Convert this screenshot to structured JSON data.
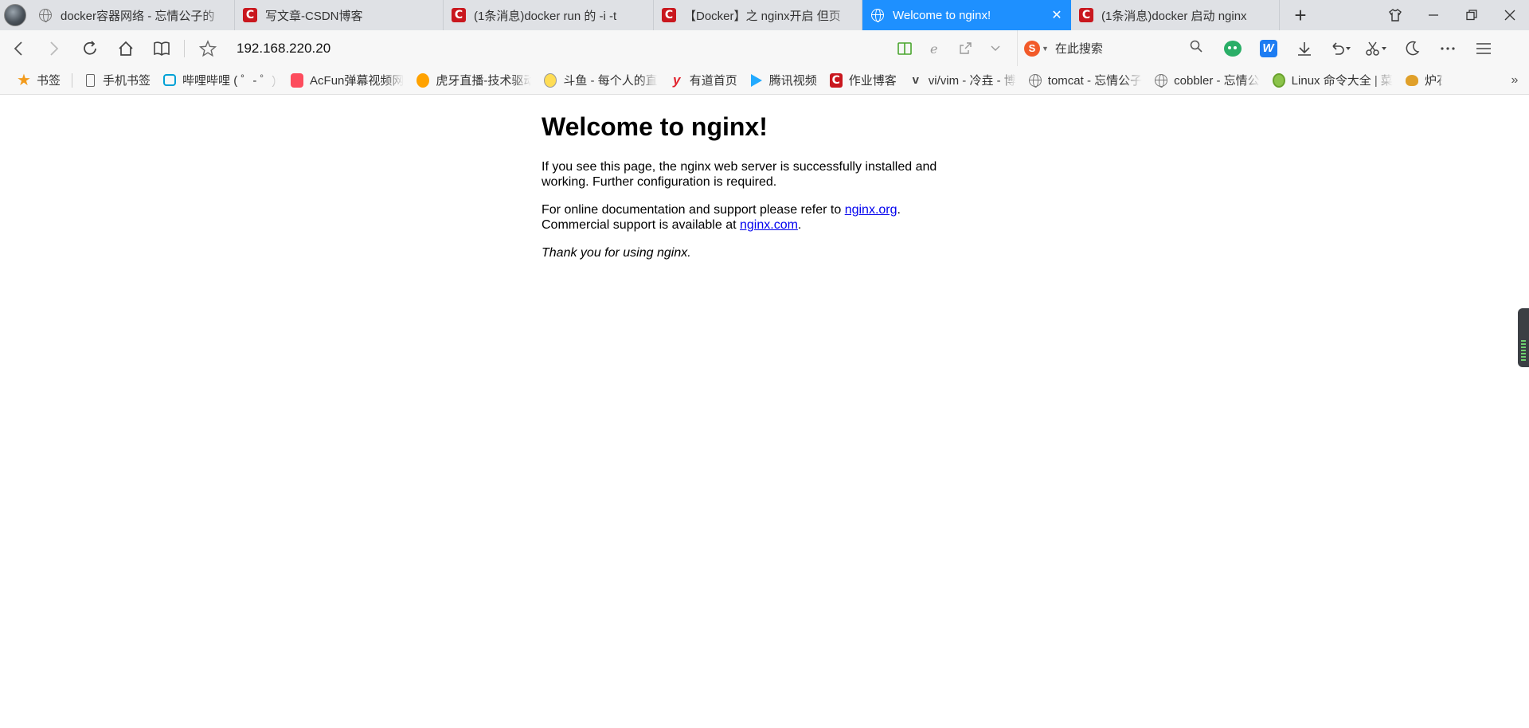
{
  "browser": {
    "tabs": [
      {
        "title": "docker容器网络 - 忘情公子的",
        "icon": "globe-icon",
        "active": false
      },
      {
        "title": "写文章-CSDN博客",
        "icon": "csdn-icon",
        "active": false
      },
      {
        "title": "(1条消息)docker run 的 -i -t",
        "icon": "csdn-icon",
        "active": false
      },
      {
        "title": "【Docker】之 nginx开启 但页",
        "icon": "csdn-icon",
        "active": false
      },
      {
        "title": "Welcome to nginx!",
        "icon": "globe-icon",
        "active": true
      },
      {
        "title": "(1条消息)docker 启动 nginx",
        "icon": "csdn-icon",
        "active": false
      }
    ],
    "new_tab_label": "+",
    "address": "192.168.220.20",
    "search_placeholder": "在此搜索",
    "colors": {
      "active_tab": "#1e90ff",
      "csdn_red": "#c9171e",
      "link": "#0000ee"
    }
  },
  "bookmarks": [
    {
      "label": "书签",
      "icon": "star-icon"
    },
    {
      "label": "手机书签",
      "icon": "phone-icon"
    },
    {
      "label": "哔哩哔哩 ( ゜- ゜)つ",
      "icon": "bilibili-icon"
    },
    {
      "label": "AcFun弹幕视频网",
      "icon": "acfun-icon"
    },
    {
      "label": "虎牙直播-技术驱动",
      "icon": "huya-icon"
    },
    {
      "label": "斗鱼 - 每个人的直",
      "icon": "douyu-icon"
    },
    {
      "label": "有道首页",
      "icon": "youdao-icon"
    },
    {
      "label": "腾讯视频",
      "icon": "tencent-video-icon"
    },
    {
      "label": "作业博客",
      "icon": "csdn-icon"
    },
    {
      "label": "vi/vim - 冷垚 - 博",
      "icon": "vim-icon"
    },
    {
      "label": "tomcat - 忘情公子",
      "icon": "globe-icon"
    },
    {
      "label": "cobbler - 忘情公",
      "icon": "globe-icon"
    },
    {
      "label": "Linux 命令大全 | 菜",
      "icon": "linux-icon"
    },
    {
      "label": "炉石",
      "icon": "bird-icon"
    }
  ],
  "page": {
    "heading": "Welcome to nginx!",
    "para1": "If you see this page, the nginx web server is successfully installed and working. Further configuration is required.",
    "para2_prefix": "For online documentation and support please refer to ",
    "link1": "nginx.org",
    "para2_mid": ".",
    "para2_prefix2": "Commercial support is available at ",
    "link2": "nginx.com",
    "para2_end": ".",
    "thanks": "Thank you for using nginx."
  }
}
